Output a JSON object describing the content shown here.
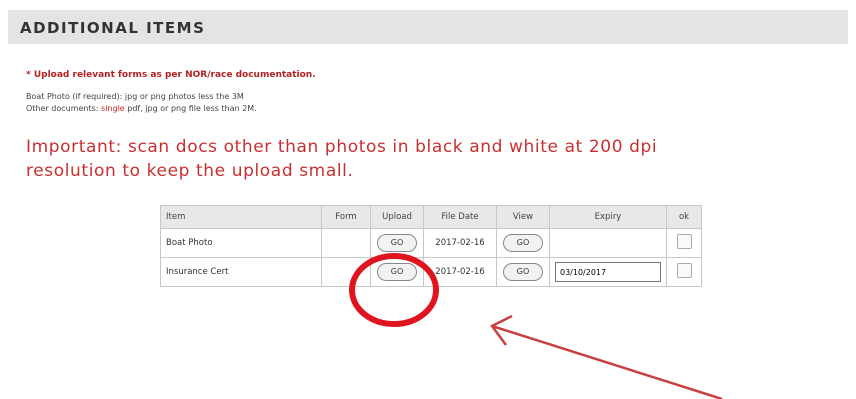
{
  "section": {
    "title": "ADDITIONAL ITEMS"
  },
  "notes": {
    "upload_note": "* Upload relevant forms as per NOR/race documentation.",
    "boat_photo_prefix": "Boat Photo (if required):",
    "boat_photo_rest": " jpg or png photos less the 3M",
    "other_docs_prefix": "Other documents: ",
    "other_docs_red": "single",
    "other_docs_rest": " pdf, jpg or png file less than 2M.",
    "important_line1": "Important: scan docs other than photos in black and white at 200 dpi",
    "important_line2": "resolution to keep the upload small."
  },
  "table": {
    "headers": [
      "Item",
      "Form",
      "Upload",
      "File Date",
      "View",
      "Expiry",
      "ok"
    ],
    "rows": [
      {
        "item": "Boat Photo",
        "form": "",
        "upload": "GO",
        "file_date": "2017-02-16",
        "view": "GO",
        "expiry": "",
        "ok": false
      },
      {
        "item": "Insurance Cert",
        "form": "",
        "upload": "GO",
        "file_date": "2017-02-16",
        "view": "GO",
        "expiry": "03/10/2017",
        "ok": false
      }
    ]
  },
  "annotation": {
    "circle_color": "#e0141e",
    "arrow_color": "#c84040"
  }
}
